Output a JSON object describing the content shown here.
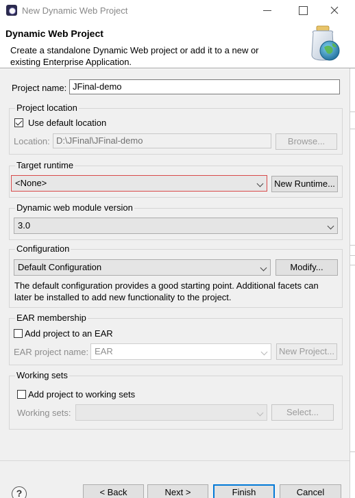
{
  "window": {
    "title": "New Dynamic Web Project",
    "controls": [
      "minimize",
      "maximize",
      "close"
    ]
  },
  "header": {
    "title": "Dynamic Web Project",
    "description": "Create a standalone Dynamic Web project or add it to a new or existing Enterprise Application."
  },
  "project_name": {
    "label": "Project name:",
    "value": "JFinal-demo"
  },
  "project_location": {
    "group_title": "Project location",
    "use_default_label": "Use default location",
    "use_default_checked": true,
    "location_label": "Location:",
    "location_value": "D:\\JFinal\\JFinal-demo",
    "browse_label": "Browse..."
  },
  "target_runtime": {
    "group_title": "Target runtime",
    "selected": "<None>",
    "new_runtime_label": "New Runtime..."
  },
  "module_version": {
    "group_title": "Dynamic web module version",
    "selected": "3.0"
  },
  "configuration": {
    "group_title": "Configuration",
    "selected": "Default Configuration",
    "modify_label": "Modify...",
    "description": "The default configuration provides a good starting point. Additional facets can later be installed to add new functionality to the project."
  },
  "ear": {
    "group_title": "EAR membership",
    "add_label": "Add project to an EAR",
    "add_checked": false,
    "name_label": "EAR project name:",
    "name_value": "EAR",
    "new_project_label": "New Project..."
  },
  "working_sets": {
    "group_title": "Working sets",
    "add_label": "Add project to working sets",
    "add_checked": false,
    "sets_label": "Working sets:",
    "sets_value": "",
    "select_label": "Select..."
  },
  "footer": {
    "help_glyph": "?",
    "back_label": "< Back",
    "next_label": "Next >",
    "finish_label": "Finish",
    "cancel_label": "Cancel"
  },
  "colors": {
    "highlight_border": "#d84a4a",
    "default_button_border": "#0078d7",
    "dialog_background": "#f0f0f0"
  }
}
